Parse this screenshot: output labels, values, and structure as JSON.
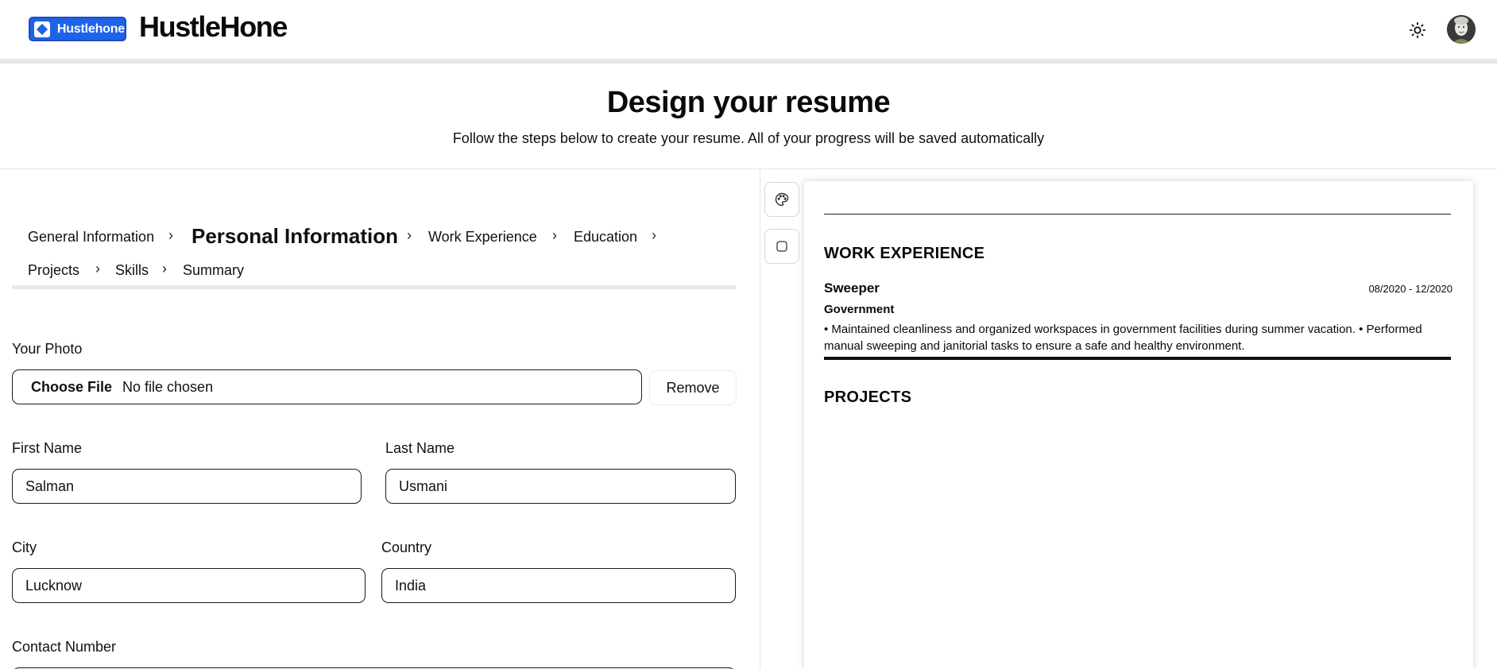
{
  "nav": {
    "logo_text": "Hustlehone",
    "brand": "HustleHone",
    "theme_icon": "sun-icon",
    "avatar_icon": "user-avatar"
  },
  "hero": {
    "title": "Design your resume",
    "subtitle": "Follow the steps below to create your resume. All of your progress will be saved automatically"
  },
  "steps": {
    "items": [
      {
        "label": "General Information",
        "active": false
      },
      {
        "label": "Personal Information",
        "active": true
      },
      {
        "label": "Work Experience",
        "active": false
      },
      {
        "label": "Education",
        "active": false
      },
      {
        "label": "Projects",
        "active": false
      },
      {
        "label": "Skills",
        "active": false
      },
      {
        "label": "Summary",
        "active": false
      }
    ],
    "separator_icon": "chevron-right-icon"
  },
  "form": {
    "photo": {
      "label": "Your Photo",
      "choose_label": "Choose File",
      "file_status": "No file chosen",
      "remove_label": "Remove"
    },
    "first_name": {
      "label": "First Name",
      "value": "Salman"
    },
    "last_name": {
      "label": "Last Name",
      "value": "Usmani"
    },
    "city": {
      "label": "City",
      "value": "Lucknow"
    },
    "country": {
      "label": "Country",
      "value": "India"
    },
    "contact": {
      "label": "Contact Number",
      "value": ""
    }
  },
  "tools": {
    "palette_icon": "palette-icon",
    "border_style_icon": "square-icon"
  },
  "preview": {
    "work_heading": "WORK EXPERIENCE",
    "job": {
      "title": "Sweeper",
      "dates": "08/2020 - 12/2020",
      "company": "Government",
      "description": "• Maintained cleanliness and organized workspaces in government facilities during summer vacation. • Performed manual sweeping and janitorial tasks to ensure a safe and healthy environment."
    },
    "projects_heading": "PROJECTS"
  }
}
